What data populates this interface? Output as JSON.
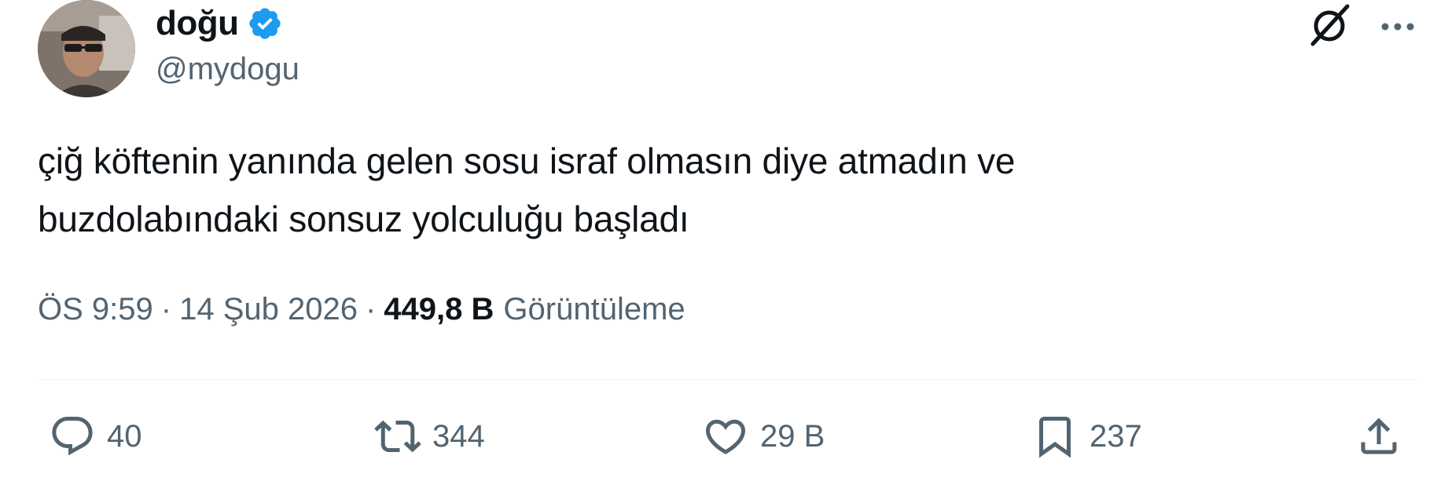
{
  "author": {
    "display_name": "doğu",
    "handle": "@mydogu",
    "verified": true,
    "verified_color": "#1d9bf0"
  },
  "header_icons": {
    "grok": "grok-icon",
    "more": "more-icon"
  },
  "tweet": {
    "text_line_1": "çiğ köftenin yanında gelen sosu israf olmasın diye atmadın ve",
    "text_line_2": "buzdolabındaki sonsuz yolculuğu başladı"
  },
  "meta": {
    "time": "ÖS 9:59",
    "separator": "·",
    "date": "14 Şub 2026",
    "views_count": "449,8 B",
    "views_label": "Görüntüleme"
  },
  "actions": {
    "replies": "40",
    "retweets": "344",
    "likes": "29 B",
    "bookmarks": "237"
  },
  "colors": {
    "text_primary": "#0f1419",
    "text_secondary": "#536471",
    "divider": "#eff3f4"
  }
}
